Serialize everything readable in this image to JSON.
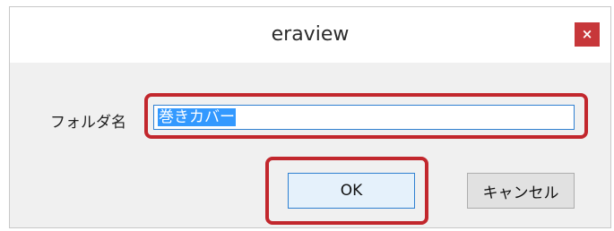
{
  "window": {
    "title": "eraview",
    "close_glyph": "×"
  },
  "form": {
    "folder_name_label": "フォルダ名",
    "folder_name_value": "巻きカバー"
  },
  "buttons": {
    "ok_label": "OK",
    "cancel_label": "キャンセル"
  },
  "colors": {
    "highlight": "#c2272d",
    "close_button": "#c7373a",
    "selection": "#3399ff",
    "focus_border": "#2f80d1"
  }
}
